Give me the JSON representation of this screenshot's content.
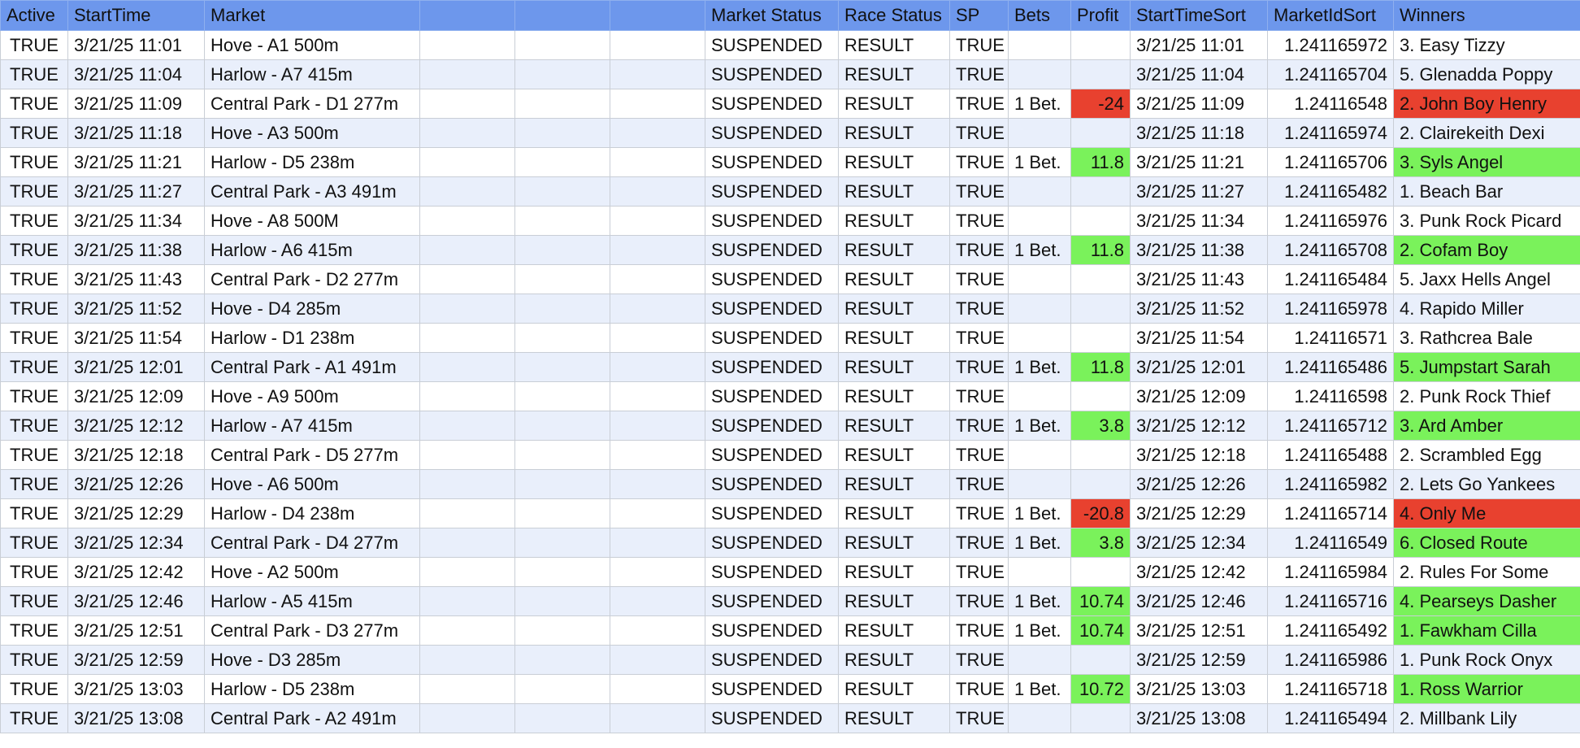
{
  "colors": {
    "header_bg": "#6d97ec",
    "row_alt_bg": "#e9effb",
    "positive": "#7af25b",
    "negative": "#e8412f"
  },
  "columns": [
    "Active",
    "StartTime",
    "Market",
    "",
    "",
    "",
    "Market Status",
    "Race Status",
    "SP",
    "Bets",
    "Profit",
    "StartTimeSort",
    "MarketIdSort",
    "Winners"
  ],
  "rows": [
    {
      "active": "TRUE",
      "start": "3/21/25 11:01",
      "market": "Hove - A1 500m",
      "mstatus": "SUSPENDED",
      "rstatus": "RESULT",
      "sp": "TRUE",
      "bets": "",
      "profit": "",
      "profit_sign": "",
      "sort": "3/21/25 11:01",
      "marketid": "1.241165972",
      "winner": "3. Easy Tizzy"
    },
    {
      "active": "TRUE",
      "start": "3/21/25 11:04",
      "market": "Harlow - A7 415m",
      "mstatus": "SUSPENDED",
      "rstatus": "RESULT",
      "sp": "TRUE",
      "bets": "",
      "profit": "",
      "profit_sign": "",
      "sort": "3/21/25 11:04",
      "marketid": "1.241165704",
      "winner": "5. Glenadda Poppy"
    },
    {
      "active": "TRUE",
      "start": "3/21/25 11:09",
      "market": "Central Park - D1 277m",
      "mstatus": "SUSPENDED",
      "rstatus": "RESULT",
      "sp": "TRUE",
      "bets": "1 Bet.",
      "profit": "-24",
      "profit_sign": "neg",
      "sort": "3/21/25 11:09",
      "marketid": "1.24116548",
      "winner": "2. John Boy Henry"
    },
    {
      "active": "TRUE",
      "start": "3/21/25 11:18",
      "market": "Hove - A3 500m",
      "mstatus": "SUSPENDED",
      "rstatus": "RESULT",
      "sp": "TRUE",
      "bets": "",
      "profit": "",
      "profit_sign": "",
      "sort": "3/21/25 11:18",
      "marketid": "1.241165974",
      "winner": "2. Clairekeith Dexi"
    },
    {
      "active": "TRUE",
      "start": "3/21/25 11:21",
      "market": "Harlow - D5 238m",
      "mstatus": "SUSPENDED",
      "rstatus": "RESULT",
      "sp": "TRUE",
      "bets": "1 Bet.",
      "profit": "11.8",
      "profit_sign": "pos",
      "sort": "3/21/25 11:21",
      "marketid": "1.241165706",
      "winner": "3. Syls Angel"
    },
    {
      "active": "TRUE",
      "start": "3/21/25 11:27",
      "market": "Central Park - A3 491m",
      "mstatus": "SUSPENDED",
      "rstatus": "RESULT",
      "sp": "TRUE",
      "bets": "",
      "profit": "",
      "profit_sign": "",
      "sort": "3/21/25 11:27",
      "marketid": "1.241165482",
      "winner": "1. Beach Bar"
    },
    {
      "active": "TRUE",
      "start": "3/21/25 11:34",
      "market": "Hove - A8 500M",
      "mstatus": "SUSPENDED",
      "rstatus": "RESULT",
      "sp": "TRUE",
      "bets": "",
      "profit": "",
      "profit_sign": "",
      "sort": "3/21/25 11:34",
      "marketid": "1.241165976",
      "winner": "3. Punk Rock Picard"
    },
    {
      "active": "TRUE",
      "start": "3/21/25 11:38",
      "market": "Harlow - A6 415m",
      "mstatus": "SUSPENDED",
      "rstatus": "RESULT",
      "sp": "TRUE",
      "bets": "1 Bet.",
      "profit": "11.8",
      "profit_sign": "pos",
      "sort": "3/21/25 11:38",
      "marketid": "1.241165708",
      "winner": "2. Cofam Boy"
    },
    {
      "active": "TRUE",
      "start": "3/21/25 11:43",
      "market": "Central Park - D2 277m",
      "mstatus": "SUSPENDED",
      "rstatus": "RESULT",
      "sp": "TRUE",
      "bets": "",
      "profit": "",
      "profit_sign": "",
      "sort": "3/21/25 11:43",
      "marketid": "1.241165484",
      "winner": "5. Jaxx Hells Angel"
    },
    {
      "active": "TRUE",
      "start": "3/21/25 11:52",
      "market": "Hove - D4 285m",
      "mstatus": "SUSPENDED",
      "rstatus": "RESULT",
      "sp": "TRUE",
      "bets": "",
      "profit": "",
      "profit_sign": "",
      "sort": "3/21/25 11:52",
      "marketid": "1.241165978",
      "winner": "4. Rapido Miller"
    },
    {
      "active": "TRUE",
      "start": "3/21/25 11:54",
      "market": "Harlow - D1 238m",
      "mstatus": "SUSPENDED",
      "rstatus": "RESULT",
      "sp": "TRUE",
      "bets": "",
      "profit": "",
      "profit_sign": "",
      "sort": "3/21/25 11:54",
      "marketid": "1.24116571",
      "winner": "3. Rathcrea Bale"
    },
    {
      "active": "TRUE",
      "start": "3/21/25 12:01",
      "market": "Central Park - A1 491m",
      "mstatus": "SUSPENDED",
      "rstatus": "RESULT",
      "sp": "TRUE",
      "bets": "1 Bet.",
      "profit": "11.8",
      "profit_sign": "pos",
      "sort": "3/21/25 12:01",
      "marketid": "1.241165486",
      "winner": "5. Jumpstart Sarah"
    },
    {
      "active": "TRUE",
      "start": "3/21/25 12:09",
      "market": "Hove - A9 500m",
      "mstatus": "SUSPENDED",
      "rstatus": "RESULT",
      "sp": "TRUE",
      "bets": "",
      "profit": "",
      "profit_sign": "",
      "sort": "3/21/25 12:09",
      "marketid": "1.24116598",
      "winner": "2. Punk Rock Thief"
    },
    {
      "active": "TRUE",
      "start": "3/21/25 12:12",
      "market": "Harlow - A7 415m",
      "mstatus": "SUSPENDED",
      "rstatus": "RESULT",
      "sp": "TRUE",
      "bets": "1 Bet.",
      "profit": "3.8",
      "profit_sign": "pos",
      "sort": "3/21/25 12:12",
      "marketid": "1.241165712",
      "winner": "3. Ard Amber"
    },
    {
      "active": "TRUE",
      "start": "3/21/25 12:18",
      "market": "Central Park - D5 277m",
      "mstatus": "SUSPENDED",
      "rstatus": "RESULT",
      "sp": "TRUE",
      "bets": "",
      "profit": "",
      "profit_sign": "",
      "sort": "3/21/25 12:18",
      "marketid": "1.241165488",
      "winner": "2. Scrambled Egg"
    },
    {
      "active": "TRUE",
      "start": "3/21/25 12:26",
      "market": "Hove - A6 500m",
      "mstatus": "SUSPENDED",
      "rstatus": "RESULT",
      "sp": "TRUE",
      "bets": "",
      "profit": "",
      "profit_sign": "",
      "sort": "3/21/25 12:26",
      "marketid": "1.241165982",
      "winner": "2. Lets Go Yankees"
    },
    {
      "active": "TRUE",
      "start": "3/21/25 12:29",
      "market": "Harlow - D4 238m",
      "mstatus": "SUSPENDED",
      "rstatus": "RESULT",
      "sp": "TRUE",
      "bets": "1 Bet.",
      "profit": "-20.8",
      "profit_sign": "neg",
      "sort": "3/21/25 12:29",
      "marketid": "1.241165714",
      "winner": "4. Only Me"
    },
    {
      "active": "TRUE",
      "start": "3/21/25 12:34",
      "market": "Central Park - D4 277m",
      "mstatus": "SUSPENDED",
      "rstatus": "RESULT",
      "sp": "TRUE",
      "bets": "1 Bet.",
      "profit": "3.8",
      "profit_sign": "pos",
      "sort": "3/21/25 12:34",
      "marketid": "1.24116549",
      "winner": "6. Closed Route"
    },
    {
      "active": "TRUE",
      "start": "3/21/25 12:42",
      "market": "Hove - A2 500m",
      "mstatus": "SUSPENDED",
      "rstatus": "RESULT",
      "sp": "TRUE",
      "bets": "",
      "profit": "",
      "profit_sign": "",
      "sort": "3/21/25 12:42",
      "marketid": "1.241165984",
      "winner": "2. Rules For Some"
    },
    {
      "active": "TRUE",
      "start": "3/21/25 12:46",
      "market": "Harlow - A5 415m",
      "mstatus": "SUSPENDED",
      "rstatus": "RESULT",
      "sp": "TRUE",
      "bets": "1 Bet.",
      "profit": "10.74",
      "profit_sign": "pos",
      "sort": "3/21/25 12:46",
      "marketid": "1.241165716",
      "winner": "4. Pearseys Dasher"
    },
    {
      "active": "TRUE",
      "start": "3/21/25 12:51",
      "market": "Central Park - D3 277m",
      "mstatus": "SUSPENDED",
      "rstatus": "RESULT",
      "sp": "TRUE",
      "bets": "1 Bet.",
      "profit": "10.74",
      "profit_sign": "pos",
      "sort": "3/21/25 12:51",
      "marketid": "1.241165492",
      "winner": "1. Fawkham Cilla"
    },
    {
      "active": "TRUE",
      "start": "3/21/25 12:59",
      "market": "Hove - D3 285m",
      "mstatus": "SUSPENDED",
      "rstatus": "RESULT",
      "sp": "TRUE",
      "bets": "",
      "profit": "",
      "profit_sign": "",
      "sort": "3/21/25 12:59",
      "marketid": "1.241165986",
      "winner": "1. Punk Rock Onyx"
    },
    {
      "active": "TRUE",
      "start": "3/21/25 13:03",
      "market": "Harlow - D5 238m",
      "mstatus": "SUSPENDED",
      "rstatus": "RESULT",
      "sp": "TRUE",
      "bets": "1 Bet.",
      "profit": "10.72",
      "profit_sign": "pos",
      "sort": "3/21/25 13:03",
      "marketid": "1.241165718",
      "winner": "1. Ross Warrior"
    },
    {
      "active": "TRUE",
      "start": "3/21/25 13:08",
      "market": "Central Park - A2 491m",
      "mstatus": "SUSPENDED",
      "rstatus": "RESULT",
      "sp": "TRUE",
      "bets": "",
      "profit": "",
      "profit_sign": "",
      "sort": "3/21/25 13:08",
      "marketid": "1.241165494",
      "winner": "2. Millbank Lily"
    }
  ]
}
